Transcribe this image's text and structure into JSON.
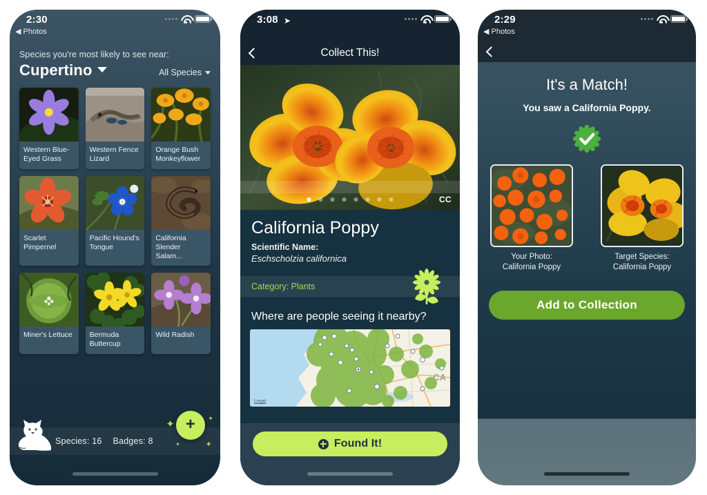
{
  "phone1": {
    "status": {
      "time": "2:30",
      "back_label": "◀ Photos",
      "signal_icon": "signal-dots-icon",
      "wifi_icon": "wifi-icon",
      "battery_icon": "battery-icon"
    },
    "header": {
      "subtitle": "Species you're most likely to see near:",
      "city": "Cupertino",
      "city_caret_icon": "chevron-down-icon",
      "filter_label": "All Species",
      "filter_caret_icon": "chevron-down-icon"
    },
    "species": [
      {
        "name": "Western Blue-Eyed Grass",
        "kind": "blue-eyed-grass"
      },
      {
        "name": "Western Fence Lizard",
        "kind": "fence-lizard"
      },
      {
        "name": "Orange Bush Monkeyflower",
        "kind": "monkeyflower"
      },
      {
        "name": "Scarlet Pimpernel",
        "kind": "pimpernel"
      },
      {
        "name": "Pacific Hound's Tongue",
        "kind": "hounds-tongue"
      },
      {
        "name": "California Slender Salam...",
        "kind": "salamander"
      },
      {
        "name": "Miner's Lettuce",
        "kind": "miners-lettuce"
      },
      {
        "name": "Bermuda Buttercup",
        "kind": "buttercup"
      },
      {
        "name": "Wild Radish",
        "kind": "wild-radish"
      }
    ],
    "stats": {
      "species_label": "Species: 16",
      "badges_label": "Badges: 8",
      "mascot_icon": "cat-mascot-icon"
    },
    "fab": {
      "icon": "plus-icon"
    }
  },
  "phone2": {
    "status": {
      "time": "3:08",
      "location_icon": "location-arrow-icon",
      "signal_icon": "signal-dots-icon",
      "wifi_icon": "wifi-icon",
      "battery_icon": "battery-icon"
    },
    "nav": {
      "title": "Collect This!",
      "back_icon": "chevron-left-icon"
    },
    "hero": {
      "cc_badge": "CC",
      "dots_total": 8,
      "dot_active": 1,
      "photo": "california-poppy-closeup"
    },
    "detail": {
      "title": "California Poppy",
      "scientific_label": "Scientific Name:",
      "scientific_name": "Eschscholzia californica",
      "category": "Category: Plants",
      "flower_icon": "flower-icon"
    },
    "map_section": {
      "question": "Where are people seeing it nearby?",
      "legal_label": "Legal",
      "region_label": "CA"
    },
    "cta": {
      "label": "Found It!",
      "icon": "plus-circle-icon"
    }
  },
  "phone3": {
    "status": {
      "time": "2:29",
      "back_label": "◀ Photos",
      "signal_icon": "signal-dots-icon",
      "wifi_icon": "wifi-icon",
      "battery_icon": "battery-icon"
    },
    "nav": {
      "back_icon": "chevron-left-icon"
    },
    "match": {
      "title": "It's a Match!",
      "subtitle": "You saw a California Poppy.",
      "check_icon": "green-check-badge-icon"
    },
    "comparison": [
      {
        "caption_line1": "Your Photo:",
        "caption_line2": "California Poppy",
        "kind": "user-poppy-field"
      },
      {
        "caption_line1": "Target Species:",
        "caption_line2": "California Poppy",
        "kind": "target-poppy-closeup"
      }
    ],
    "cta": {
      "label": "Add to Collection"
    }
  },
  "colors": {
    "accent_green": "#c6ee5e",
    "button_green": "#6aa72c",
    "category_green": "#a5d94e",
    "panel_slate": "#3a5566",
    "bg_dark_navy": "#16313f"
  }
}
